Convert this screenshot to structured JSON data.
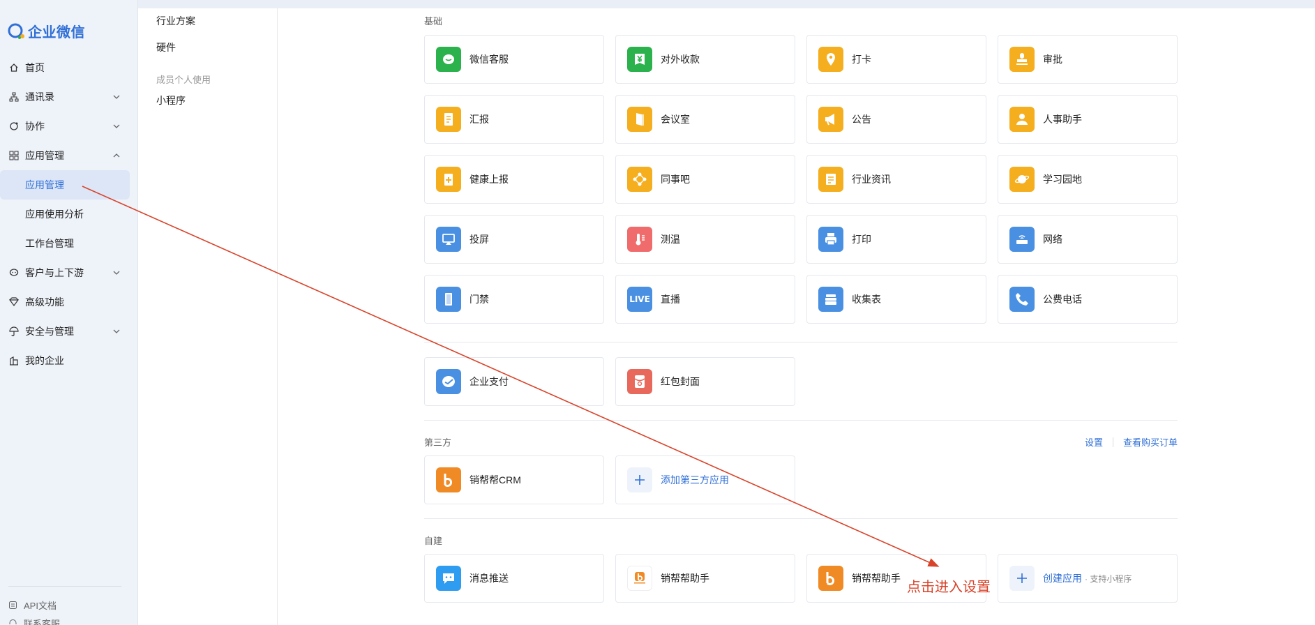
{
  "brand": {
    "name": "企业微信",
    "accent": "#2f6fd6"
  },
  "nav": {
    "items": [
      {
        "label": "首页",
        "icon": "home-icon"
      },
      {
        "label": "通讯录",
        "icon": "org-chart-icon"
      },
      {
        "label": "协作",
        "icon": "collaboration-icon"
      },
      {
        "label": "应用管理",
        "icon": "apps-grid-icon"
      }
    ],
    "sub_items": [
      {
        "label": "应用管理"
      },
      {
        "label": "应用使用分析"
      },
      {
        "label": "工作台管理"
      }
    ],
    "items2": [
      {
        "label": "客户与上下游",
        "icon": "chat-bubble-icon"
      },
      {
        "label": "高级功能",
        "icon": "diamond-icon"
      },
      {
        "label": "安全与管理",
        "icon": "umbrella-icon"
      },
      {
        "label": "我的企业",
        "icon": "building-icon"
      }
    ],
    "footer": [
      {
        "label": "API文档",
        "icon": "doc-icon"
      },
      {
        "label": "联系客服",
        "icon": "headset-icon"
      }
    ]
  },
  "col2": {
    "items_top": [
      "行业方案",
      "硬件"
    ],
    "group_label": "成员个人使用",
    "items_bottom": [
      "小程序"
    ]
  },
  "main": {
    "basic": {
      "title": "基础",
      "apps": [
        {
          "name": "微信客服",
          "icon": "wechat-service-icon",
          "color": "#2bb24c"
        },
        {
          "name": "对外收款",
          "icon": "yuan-icon",
          "color": "#2bb24c"
        },
        {
          "name": "打卡",
          "icon": "location-pin-icon",
          "color": "#f5ae1e"
        },
        {
          "name": "审批",
          "icon": "stamp-icon",
          "color": "#f5ae1e"
        },
        {
          "name": "汇报",
          "icon": "report-icon",
          "color": "#f5ae1e"
        },
        {
          "name": "会议室",
          "icon": "door-icon",
          "color": "#f5ae1e"
        },
        {
          "name": "公告",
          "icon": "megaphone-icon",
          "color": "#f5ae1e"
        },
        {
          "name": "人事助手",
          "icon": "person-icon",
          "color": "#f5ae1e"
        },
        {
          "name": "健康上报",
          "icon": "health-icon",
          "color": "#f5ae1e"
        },
        {
          "name": "同事吧",
          "icon": "network-icon",
          "color": "#f5ae1e"
        },
        {
          "name": "行业资讯",
          "icon": "news-icon",
          "color": "#f5ae1e"
        },
        {
          "name": "学习园地",
          "icon": "planet-icon",
          "color": "#f5ae1e"
        },
        {
          "name": "投屏",
          "icon": "cast-icon",
          "color": "#4a90e2"
        },
        {
          "name": "测温",
          "icon": "thermometer-icon",
          "color": "#f06b6b"
        },
        {
          "name": "打印",
          "icon": "printer-icon",
          "color": "#4a90e2"
        },
        {
          "name": "网络",
          "icon": "router-icon",
          "color": "#4a90e2"
        },
        {
          "name": "门禁",
          "icon": "access-door-icon",
          "color": "#4a90e2"
        },
        {
          "name": "直播",
          "icon": "live-icon",
          "color": "#4a90e2",
          "badge": "LIVE"
        },
        {
          "name": "收集表",
          "icon": "stack-icon",
          "color": "#4a90e2"
        },
        {
          "name": "公费电话",
          "icon": "phone-icon",
          "color": "#4a90e2"
        }
      ]
    },
    "pay": {
      "apps": [
        {
          "name": "企业支付",
          "icon": "pay-icon",
          "color": "#4a90e2"
        },
        {
          "name": "红包封面",
          "icon": "red-packet-icon",
          "color": "#e8685b"
        }
      ]
    },
    "third": {
      "title": "第三方",
      "links": [
        "设置",
        "查看购买订单"
      ],
      "apps": [
        {
          "name": "销帮帮CRM",
          "icon": "xbb-logo-icon",
          "color": "#f08a24"
        },
        {
          "name": "添加第三方应用",
          "icon": "plus-icon",
          "color": "#eef3fb",
          "link": true
        }
      ]
    },
    "custom": {
      "title": "自建",
      "apps": [
        {
          "name": "消息推送",
          "icon": "message-push-icon",
          "color": "#2e9cf0"
        },
        {
          "name": "销帮帮助手",
          "icon": "xbb-small-logo-icon",
          "color": "#ffffff"
        },
        {
          "name": "销帮帮助手",
          "icon": "xbb-logo-icon",
          "color": "#f08a24"
        },
        {
          "name": "创建应用",
          "sub": "· 支持小程序",
          "icon": "plus-icon",
          "color": "#eef3fb",
          "link": true
        }
      ]
    }
  },
  "annotation": {
    "text": "点击进入设置",
    "color": "#d9432a"
  }
}
